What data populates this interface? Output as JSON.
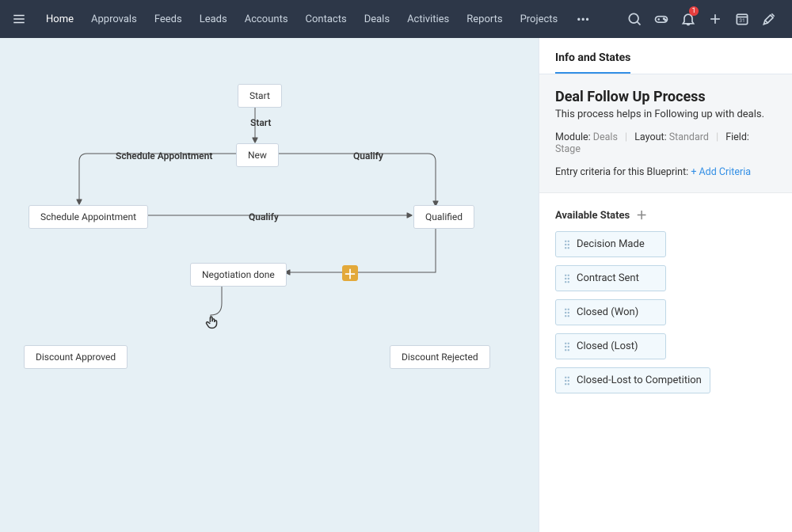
{
  "nav": {
    "tabs": [
      "Home",
      "Approvals",
      "Feeds",
      "Leads",
      "Accounts",
      "Contacts",
      "Deals",
      "Activities",
      "Reports",
      "Projects"
    ],
    "more": "•••",
    "notif_badge": "1"
  },
  "sidebar": {
    "tab": "Info and States",
    "title": "Deal Follow Up Process",
    "desc": "This process helps in Following up with deals.",
    "meta": {
      "module_label": "Module:",
      "module_value": "Deals",
      "layout_label": "Layout:",
      "layout_value": "Standard",
      "field_label": "Field:",
      "field_value": "Stage"
    },
    "entry": {
      "label": "Entry criteria for this Blueprint:",
      "link": "+ Add Criteria"
    },
    "states_label": "Available States",
    "states": [
      "Decision Made",
      "Contract Sent",
      "Closed (Won)",
      "Closed (Lost)",
      "Closed-Lost to Competition"
    ]
  },
  "diagram": {
    "nodes": {
      "start": "Start",
      "new": "New",
      "schedule": "Schedule Appointment",
      "qualified": "Qualified",
      "negdone": "Negotiation done",
      "disc_approved": "Discount Approved",
      "disc_rejected": "Discount Rejected"
    },
    "transitions": {
      "start": "Start",
      "schedule": "Schedule Appointment",
      "qualify1": "Qualify",
      "qualify2": "Qualify"
    }
  }
}
